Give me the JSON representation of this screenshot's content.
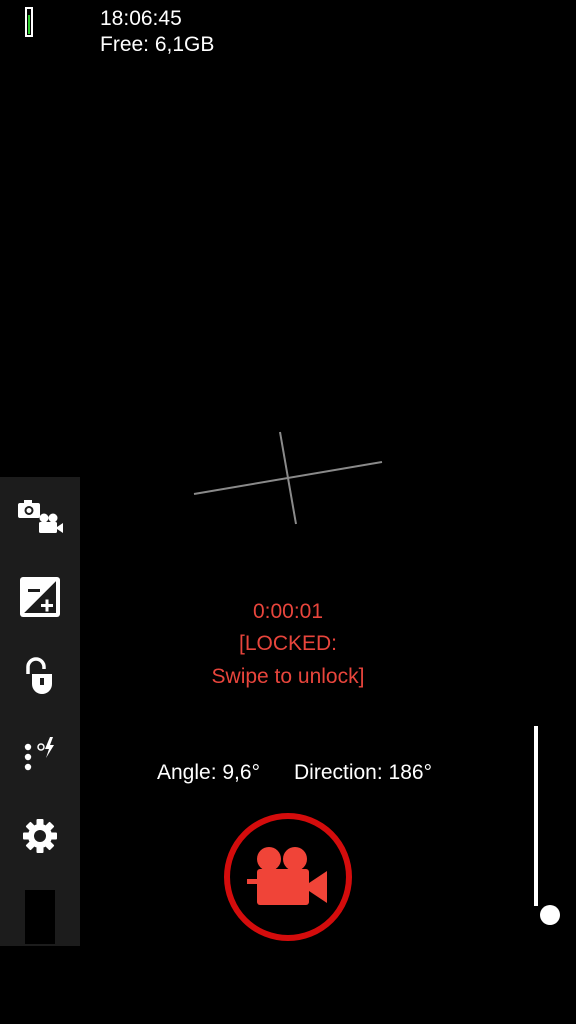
{
  "status": {
    "time": "18:06:45",
    "free_storage": "Free: 6,1GB",
    "battery_level": 0.8,
    "battery_color": "#2ec92e"
  },
  "recording": {
    "elapsed": "0:00:01",
    "lock_line1": "[LOCKED:",
    "lock_line2": "Swipe to unlock]",
    "text_color": "#e8453c"
  },
  "info": {
    "angle": "Angle: 9,6°",
    "direction": "Direction: 186°"
  },
  "toolbar": {
    "items": [
      {
        "icon": "camera-video-switch-icon"
      },
      {
        "icon": "exposure-icon"
      },
      {
        "icon": "exposure-lock-icon"
      },
      {
        "icon": "flash-auto-icon"
      },
      {
        "icon": "gear-icon"
      }
    ]
  },
  "record_button": {
    "icon": "video-camera-icon",
    "ring_color": "#d40c0c",
    "icon_color": "#f04438"
  },
  "zoom": {
    "level": 0
  }
}
